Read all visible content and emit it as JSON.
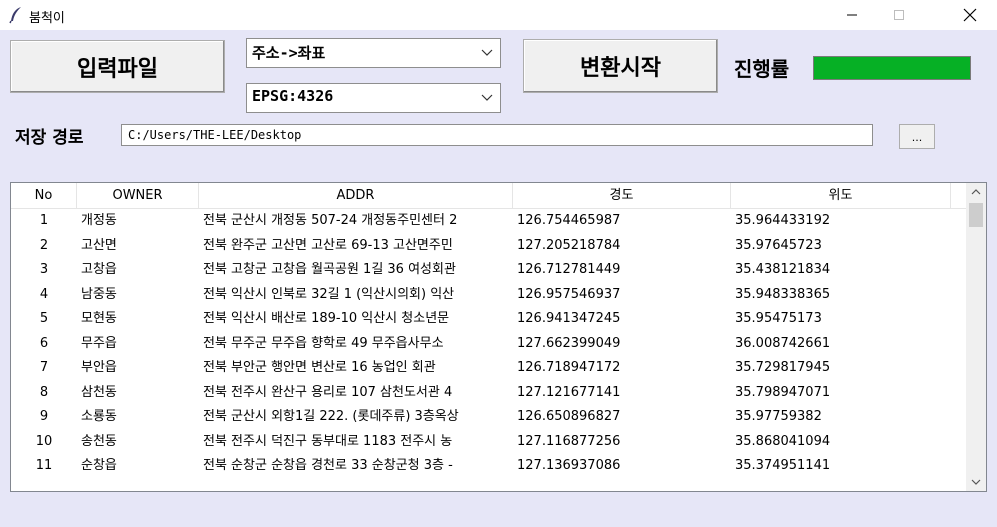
{
  "window": {
    "title": "붐척이",
    "icons": [
      "feather-icon",
      "minimize-icon",
      "maximize-icon",
      "close-icon"
    ]
  },
  "toolbar": {
    "input_file_label": "입력파일",
    "mode_value": "주소->좌표",
    "epsg_value": "EPSG:4326",
    "start_label": "변환시작",
    "progress_label": "진행률",
    "progress_value": 1.0,
    "progress_color": "#06b025"
  },
  "save": {
    "label": "저장 경로",
    "path": "C:/Users/THE-LEE/Desktop",
    "browse_label": "..."
  },
  "table": {
    "columns": [
      "No",
      "OWNER",
      "ADDR",
      "경도",
      "위도"
    ],
    "rows": [
      {
        "no": "1",
        "owner": "개정동",
        "addr": "전북 군산시 개정동 507-24 개정동주민센터 2",
        "lng": "126.754465987",
        "lat": "35.964433192"
      },
      {
        "no": "2",
        "owner": "고산면",
        "addr": "전북 완주군 고산면 고산로 69-13 고산면주민",
        "lng": "127.205218784",
        "lat": "35.97645723"
      },
      {
        "no": "3",
        "owner": "고창읍",
        "addr": "전북 고창군 고창읍 월곡공원 1길 36 여성회관",
        "lng": "126.712781449",
        "lat": "35.438121834"
      },
      {
        "no": "4",
        "owner": "남중동",
        "addr": "전북 익산시 인북로 32길 1 (익산시의회) 익산",
        "lng": "126.957546937",
        "lat": "35.948338365"
      },
      {
        "no": "5",
        "owner": "모현동",
        "addr": "전북 익산시 배산로 189-10 익산시 청소년문",
        "lng": "126.941347245",
        "lat": "35.95475173"
      },
      {
        "no": "6",
        "owner": "무주읍",
        "addr": "전북 무주군 무주읍 향학로 49 무주읍사무소",
        "lng": "127.662399049",
        "lat": "36.008742661"
      },
      {
        "no": "7",
        "owner": "부안읍",
        "addr": "전북 부안군 행안면 변산로 16 농업인 회관",
        "lng": "126.718947172",
        "lat": "35.729817945"
      },
      {
        "no": "8",
        "owner": "삼천동",
        "addr": "전북 전주시 완산구 용리로 107 삼천도서관 4",
        "lng": "127.121677141",
        "lat": "35.798947071"
      },
      {
        "no": "9",
        "owner": "소룡동",
        "addr": "전북 군산시 외항1길 222. (롯데주류) 3층옥상",
        "lng": "126.650896827",
        "lat": "35.97759382"
      },
      {
        "no": "10",
        "owner": "송천동",
        "addr": "전북 전주시 덕진구 동부대로 1183 전주시 농",
        "lng": "127.116877256",
        "lat": "35.868041094"
      },
      {
        "no": "11",
        "owner": "순창읍",
        "addr": "전북 순창군 순창읍 경천로 33 순창군청 3층 -",
        "lng": "127.136937086",
        "lat": "35.374951141"
      }
    ]
  }
}
